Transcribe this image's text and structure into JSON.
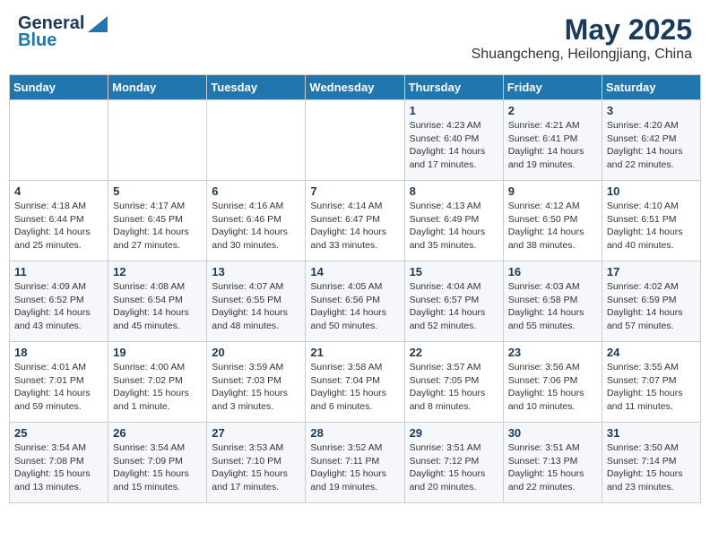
{
  "header": {
    "logo_general": "General",
    "logo_blue": "Blue",
    "month": "May 2025",
    "location": "Shuangcheng, Heilongjiang, China"
  },
  "weekdays": [
    "Sunday",
    "Monday",
    "Tuesday",
    "Wednesday",
    "Thursday",
    "Friday",
    "Saturday"
  ],
  "weeks": [
    [
      {
        "day": "",
        "info": ""
      },
      {
        "day": "",
        "info": ""
      },
      {
        "day": "",
        "info": ""
      },
      {
        "day": "",
        "info": ""
      },
      {
        "day": "1",
        "info": "Sunrise: 4:23 AM\nSunset: 6:40 PM\nDaylight: 14 hours\nand 17 minutes."
      },
      {
        "day": "2",
        "info": "Sunrise: 4:21 AM\nSunset: 6:41 PM\nDaylight: 14 hours\nand 19 minutes."
      },
      {
        "day": "3",
        "info": "Sunrise: 4:20 AM\nSunset: 6:42 PM\nDaylight: 14 hours\nand 22 minutes."
      }
    ],
    [
      {
        "day": "4",
        "info": "Sunrise: 4:18 AM\nSunset: 6:44 PM\nDaylight: 14 hours\nand 25 minutes."
      },
      {
        "day": "5",
        "info": "Sunrise: 4:17 AM\nSunset: 6:45 PM\nDaylight: 14 hours\nand 27 minutes."
      },
      {
        "day": "6",
        "info": "Sunrise: 4:16 AM\nSunset: 6:46 PM\nDaylight: 14 hours\nand 30 minutes."
      },
      {
        "day": "7",
        "info": "Sunrise: 4:14 AM\nSunset: 6:47 PM\nDaylight: 14 hours\nand 33 minutes."
      },
      {
        "day": "8",
        "info": "Sunrise: 4:13 AM\nSunset: 6:49 PM\nDaylight: 14 hours\nand 35 minutes."
      },
      {
        "day": "9",
        "info": "Sunrise: 4:12 AM\nSunset: 6:50 PM\nDaylight: 14 hours\nand 38 minutes."
      },
      {
        "day": "10",
        "info": "Sunrise: 4:10 AM\nSunset: 6:51 PM\nDaylight: 14 hours\nand 40 minutes."
      }
    ],
    [
      {
        "day": "11",
        "info": "Sunrise: 4:09 AM\nSunset: 6:52 PM\nDaylight: 14 hours\nand 43 minutes."
      },
      {
        "day": "12",
        "info": "Sunrise: 4:08 AM\nSunset: 6:54 PM\nDaylight: 14 hours\nand 45 minutes."
      },
      {
        "day": "13",
        "info": "Sunrise: 4:07 AM\nSunset: 6:55 PM\nDaylight: 14 hours\nand 48 minutes."
      },
      {
        "day": "14",
        "info": "Sunrise: 4:05 AM\nSunset: 6:56 PM\nDaylight: 14 hours\nand 50 minutes."
      },
      {
        "day": "15",
        "info": "Sunrise: 4:04 AM\nSunset: 6:57 PM\nDaylight: 14 hours\nand 52 minutes."
      },
      {
        "day": "16",
        "info": "Sunrise: 4:03 AM\nSunset: 6:58 PM\nDaylight: 14 hours\nand 55 minutes."
      },
      {
        "day": "17",
        "info": "Sunrise: 4:02 AM\nSunset: 6:59 PM\nDaylight: 14 hours\nand 57 minutes."
      }
    ],
    [
      {
        "day": "18",
        "info": "Sunrise: 4:01 AM\nSunset: 7:01 PM\nDaylight: 14 hours\nand 59 minutes."
      },
      {
        "day": "19",
        "info": "Sunrise: 4:00 AM\nSunset: 7:02 PM\nDaylight: 15 hours\nand 1 minute."
      },
      {
        "day": "20",
        "info": "Sunrise: 3:59 AM\nSunset: 7:03 PM\nDaylight: 15 hours\nand 3 minutes."
      },
      {
        "day": "21",
        "info": "Sunrise: 3:58 AM\nSunset: 7:04 PM\nDaylight: 15 hours\nand 6 minutes."
      },
      {
        "day": "22",
        "info": "Sunrise: 3:57 AM\nSunset: 7:05 PM\nDaylight: 15 hours\nand 8 minutes."
      },
      {
        "day": "23",
        "info": "Sunrise: 3:56 AM\nSunset: 7:06 PM\nDaylight: 15 hours\nand 10 minutes."
      },
      {
        "day": "24",
        "info": "Sunrise: 3:55 AM\nSunset: 7:07 PM\nDaylight: 15 hours\nand 11 minutes."
      }
    ],
    [
      {
        "day": "25",
        "info": "Sunrise: 3:54 AM\nSunset: 7:08 PM\nDaylight: 15 hours\nand 13 minutes."
      },
      {
        "day": "26",
        "info": "Sunrise: 3:54 AM\nSunset: 7:09 PM\nDaylight: 15 hours\nand 15 minutes."
      },
      {
        "day": "27",
        "info": "Sunrise: 3:53 AM\nSunset: 7:10 PM\nDaylight: 15 hours\nand 17 minutes."
      },
      {
        "day": "28",
        "info": "Sunrise: 3:52 AM\nSunset: 7:11 PM\nDaylight: 15 hours\nand 19 minutes."
      },
      {
        "day": "29",
        "info": "Sunrise: 3:51 AM\nSunset: 7:12 PM\nDaylight: 15 hours\nand 20 minutes."
      },
      {
        "day": "30",
        "info": "Sunrise: 3:51 AM\nSunset: 7:13 PM\nDaylight: 15 hours\nand 22 minutes."
      },
      {
        "day": "31",
        "info": "Sunrise: 3:50 AM\nSunset: 7:14 PM\nDaylight: 15 hours\nand 23 minutes."
      }
    ]
  ]
}
